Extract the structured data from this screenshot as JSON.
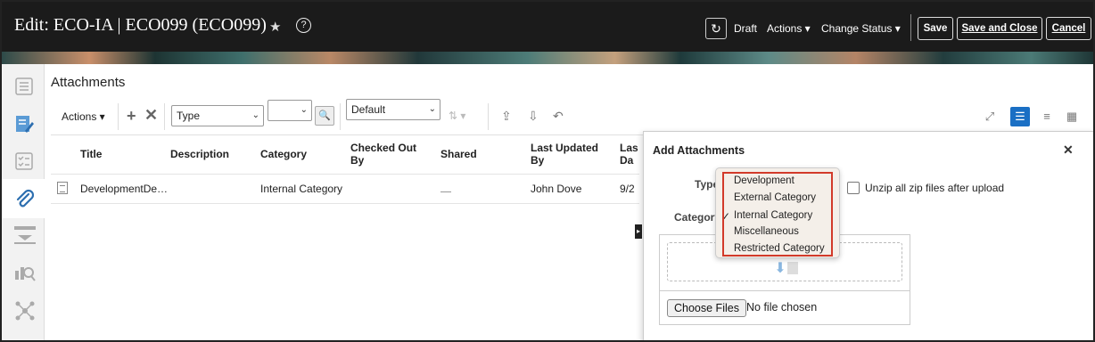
{
  "header": {
    "title": "Edit: ECO-IA | ECO099 (ECO099)",
    "draft_label": "Draft",
    "actions_label": "Actions ▾",
    "change_status_label": "Change Status ▾",
    "save_label": "Save",
    "save_close_label": "Save and Close",
    "cancel_label": "Cancel",
    "star_glyph": "★",
    "help_glyph": "?",
    "refresh_glyph": "↻"
  },
  "section": {
    "title": "Attachments"
  },
  "toolbar": {
    "actions_label": "Actions ▾",
    "type_select_value": "Type",
    "view_select_value": "Default",
    "sort_glyph": "⇅ ▾"
  },
  "table": {
    "columns": [
      "Title",
      "Description",
      "Category",
      "Checked Out By",
      "Shared",
      "Last Updated By",
      "Last Date"
    ],
    "column_labels": {
      "title": "Title",
      "description": "Description",
      "category": "Category",
      "checked_out_1": "Checked Out",
      "checked_out_2": "By",
      "shared": "Shared",
      "last_updated_1": "Last Updated",
      "last_updated_2": "By",
      "last_date_1": "Las",
      "last_date_2": "Da"
    },
    "rows": [
      {
        "title": "DevelopmentDe…",
        "description": "",
        "category": "Internal Category",
        "checked_out_by": "",
        "shared": "",
        "last_updated_by": "John Dove",
        "last_date": "9/2"
      }
    ]
  },
  "panel": {
    "title": "Add Attachments",
    "close_glyph": "✕",
    "type_label": "Type",
    "category_label": "Category",
    "unzip_label": "Unzip all zip files after upload",
    "choose_files_label": "Choose Files",
    "no_file_text": "No file chosen"
  },
  "category_dropdown": {
    "options": [
      "Development",
      "External Category",
      "Internal Category",
      "Miscellaneous",
      "Restricted Category"
    ],
    "selected": "Internal Category",
    "check_glyph": "✓"
  },
  "colors": {
    "header_bg": "#1b1b1b",
    "accent": "#1a6fc4",
    "highlight": "#d23a2a"
  },
  "icons": {
    "rail": [
      "overview-icon",
      "edit-document-icon",
      "checklist-icon",
      "paperclip-icon",
      "download-icon",
      "search-document-icon",
      "network-icon"
    ],
    "right_tools": [
      "expand-icon",
      "card-view-icon",
      "list-view-icon",
      "grid-view-icon"
    ]
  }
}
